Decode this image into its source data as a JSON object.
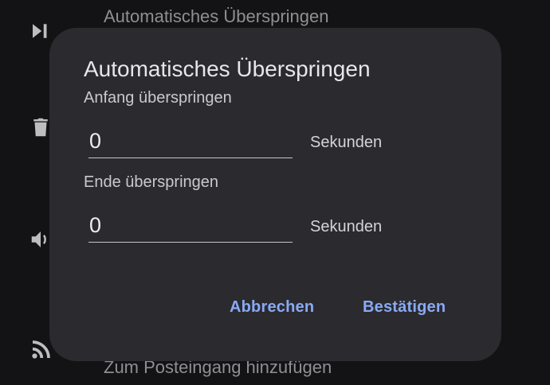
{
  "background": {
    "top_item_label": "Automatisches Überspringen",
    "bottom_item_label": "Zum Posteingang hinzufügen",
    "icons": [
      "skip-next-icon",
      "trash-icon",
      "volume-icon",
      "rss-icon"
    ]
  },
  "dialog": {
    "title": "Automatisches Überspringen",
    "skip_start_label": "Anfang überspringen",
    "skip_start_value": "0",
    "skip_start_unit": "Sekunden",
    "skip_end_label": "Ende überspringen",
    "skip_end_value": "0",
    "skip_end_unit": "Sekunden",
    "cancel_label": "Abbrechen",
    "confirm_label": "Bestätigen"
  },
  "colors": {
    "background": "#131315",
    "dialog": "#2a2a2f",
    "accent": "#8aa9f3"
  }
}
